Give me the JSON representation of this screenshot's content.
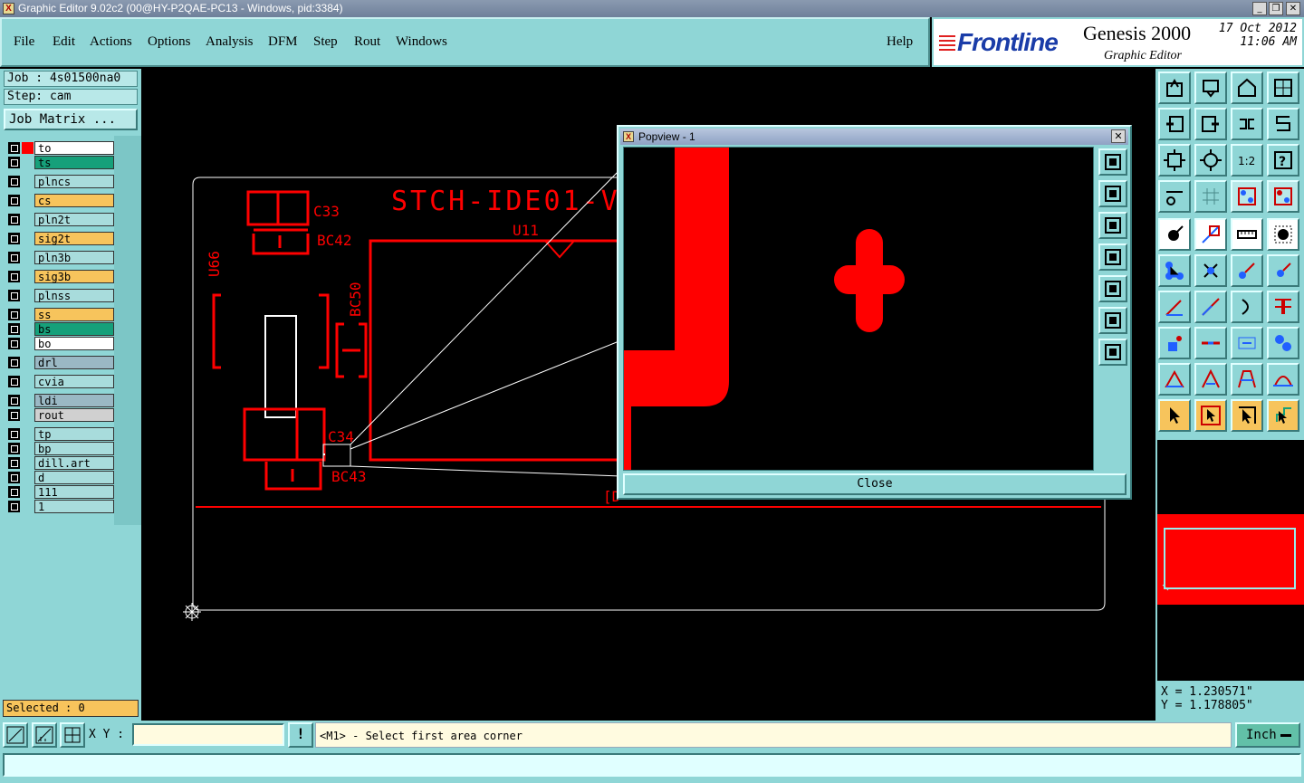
{
  "window": {
    "title": "Graphic Editor 9.02c2 (00@HY-P2QAE-PC13 - Windows, pid:3384)",
    "controls": [
      "_",
      "❐",
      "✕"
    ]
  },
  "menu": {
    "items": [
      "File",
      "Edit",
      "Actions",
      "Options",
      "Analysis",
      "DFM",
      "Step",
      "Rout",
      "Windows"
    ],
    "help": "Help"
  },
  "brand": {
    "logo": "Frontline",
    "product": "Genesis 2000",
    "subtitle": "Graphic Editor",
    "date": "17 Oct 2012",
    "time": "11:06 AM"
  },
  "job": {
    "job_line": "Job : 4s01500na0",
    "step_line": "Step: cam",
    "matrix_button": "Job Matrix ..."
  },
  "layers": [
    {
      "name": "to",
      "color": "#ffffff"
    },
    {
      "name": "ts",
      "color": "#16a07a"
    },
    {
      "name": "plncs",
      "color": "#a8dcdc"
    },
    {
      "name": "cs",
      "color": "#f7c45c"
    },
    {
      "name": "pln2t",
      "color": "#a8dcdc"
    },
    {
      "name": "sig2t",
      "color": "#f7c45c"
    },
    {
      "name": "pln3b",
      "color": "#a8dcdc"
    },
    {
      "name": "sig3b",
      "color": "#f7c45c"
    },
    {
      "name": "plnss",
      "color": "#a8dcdc"
    },
    {
      "name": "ss",
      "color": "#f7c45c"
    },
    {
      "name": "bs",
      "color": "#16a07a"
    },
    {
      "name": "bo",
      "color": "#ffffff"
    },
    {
      "name": "drl",
      "color": "#9ab8c4"
    },
    {
      "name": "cvia",
      "color": "#a8dcdc"
    },
    {
      "name": "ldi",
      "color": "#9ab8c4"
    },
    {
      "name": "rout",
      "color": "#d0d0d0"
    },
    {
      "name": "tp",
      "color": "#a8dcdc"
    },
    {
      "name": "bp",
      "color": "#a8dcdc"
    },
    {
      "name": "dill.art",
      "color": "#a8dcdc"
    },
    {
      "name": "d",
      "color": "#a8dcdc"
    },
    {
      "name": "111",
      "color": "#a8dcdc"
    },
    {
      "name": "1",
      "color": "#a8dcdc"
    }
  ],
  "selected": "Selected : 0",
  "board_labels": {
    "title": "STCH-IDE01-V",
    "c33": "C33",
    "bc42": "BC42",
    "u66": "U66",
    "u11": "U11",
    "bc50": "BC50",
    "c34": "C34",
    "bc43": "BC43"
  },
  "popview": {
    "title": "Popview - 1",
    "close_label": "Close"
  },
  "coords": {
    "x": "X  = 1.230571\"",
    "y": "Y  = 1.178805\""
  },
  "bottom": {
    "xy_label": "X Y :",
    "xy_value": "",
    "alert": "!",
    "message": "<M1> - Select first area corner",
    "unit": "Inch"
  },
  "colors": {
    "panel": "#8fd6d6",
    "pcb_red": "#ff0000",
    "outline": "#ffffff"
  }
}
